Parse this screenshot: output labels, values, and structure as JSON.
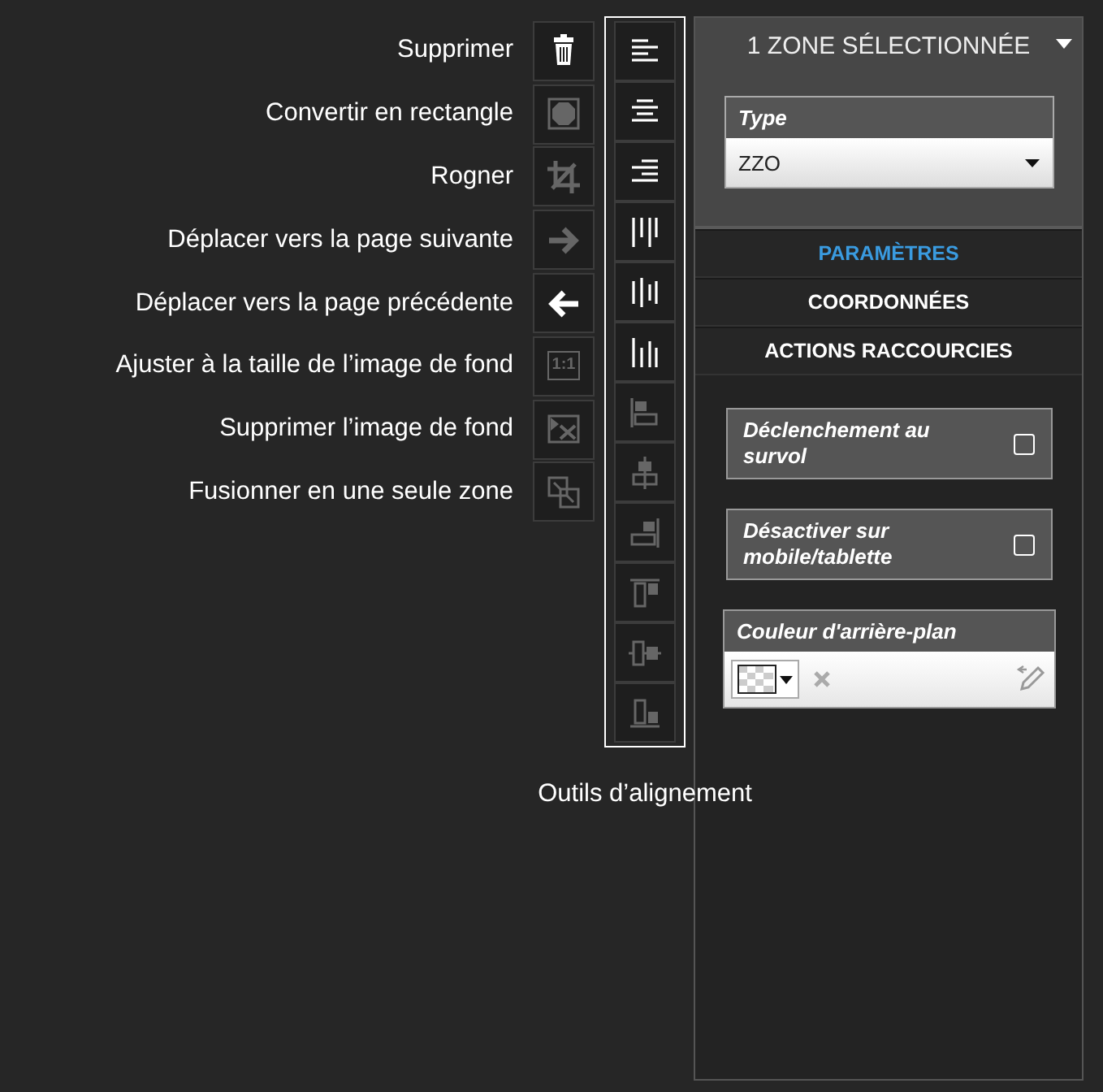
{
  "tools": [
    {
      "label": "Supprimer",
      "kind": "trash",
      "disabled": false
    },
    {
      "label": "Convertir en rectangle",
      "kind": "convert",
      "disabled": true
    },
    {
      "label": "Rogner",
      "kind": "crop",
      "disabled": true
    },
    {
      "label": "Déplacer vers la page suivante",
      "kind": "arrow-right",
      "disabled": true
    },
    {
      "label": "Déplacer vers la page précédente",
      "kind": "arrow-left",
      "disabled": false
    },
    {
      "label": "Ajuster à la taille de l’image de fond",
      "kind": "ratio",
      "badge": "1:1",
      "disabled": true
    },
    {
      "label": "Supprimer l’image de fond",
      "kind": "remove-image",
      "disabled": true
    },
    {
      "label": "Fusionner en une seule zone",
      "kind": "merge",
      "disabled": true
    }
  ],
  "alignment": {
    "caption": "Outils d’alignement",
    "tools": [
      {
        "kind": "text-left",
        "disabled": false
      },
      {
        "kind": "text-center",
        "disabled": false
      },
      {
        "kind": "text-right",
        "disabled": false
      },
      {
        "kind": "dist-left",
        "disabled": false
      },
      {
        "kind": "dist-center",
        "disabled": false
      },
      {
        "kind": "dist-right",
        "disabled": false
      },
      {
        "kind": "align-left",
        "disabled": true
      },
      {
        "kind": "align-center",
        "disabled": true
      },
      {
        "kind": "align-right",
        "disabled": true
      },
      {
        "kind": "align-top",
        "disabled": true
      },
      {
        "kind": "align-middle",
        "disabled": true
      },
      {
        "kind": "align-bottom",
        "disabled": true
      }
    ]
  },
  "panel": {
    "title": "1 ZONE SÉLECTIONNÉE",
    "type_field": {
      "label": "Type",
      "value": "ZZO"
    },
    "tabs": [
      {
        "label": "PARAMÈTRES",
        "selected": true
      },
      {
        "label": "COORDONNÉES",
        "selected": false
      },
      {
        "label": "ACTIONS RACCOURCIES",
        "selected": false
      }
    ],
    "options": [
      {
        "label": "Déclenchement au survol",
        "checked": false
      },
      {
        "label": "Désactiver sur mobile/tablette",
        "checked": false
      }
    ],
    "color": {
      "label": "Couleur d'arrière-plan"
    }
  }
}
